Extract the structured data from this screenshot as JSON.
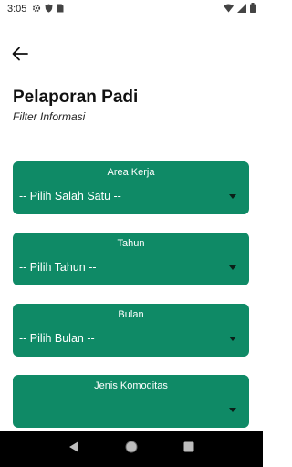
{
  "status_bar": {
    "time": "3:05"
  },
  "page": {
    "title": "Pelaporan Padi",
    "subtitle": "Filter Informasi"
  },
  "filters": [
    {
      "label": "Area Kerja",
      "value": "-- Pilih Salah Satu --"
    },
    {
      "label": "Tahun",
      "value": "-- Pilih Tahun --"
    },
    {
      "label": "Bulan",
      "value": "-- Pilih Bulan --"
    },
    {
      "label": "Jenis Komoditas",
      "value": "-"
    }
  ],
  "colors": {
    "card": "#0f8a66",
    "nav_bar": "#000000"
  },
  "icons": {
    "back": "arrow-left-icon",
    "settings": "gear-icon",
    "shield": "shield-icon",
    "sim": "sim-card-icon",
    "wifi": "wifi-icon",
    "signal": "signal-icon",
    "battery": "battery-icon",
    "nav_back": "triangle-back-icon",
    "nav_home": "circle-home-icon",
    "nav_recents": "square-recents-icon"
  }
}
